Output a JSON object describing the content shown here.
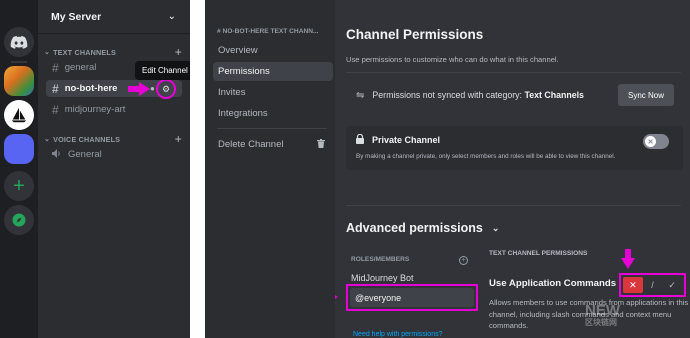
{
  "colors": {
    "highlight": "#e600d6",
    "blurple": "#5865f2",
    "deny_red": "#da373c",
    "link": "#00a8fc",
    "add_green": "#23a55a"
  },
  "server": {
    "name": "My Server",
    "dropdown_icon": "chevron-down-icon"
  },
  "server_rail": {
    "icons": [
      "discord-icon",
      "server-image-icon",
      "sailboat-server-icon",
      "active-server-icon",
      "add-server-icon",
      "explore-servers-icon"
    ],
    "add_symbol": "+"
  },
  "text_channels": {
    "label": "TEXT CHANNELS",
    "add_symbol": "+",
    "items": [
      {
        "hash": "#",
        "name": "general"
      },
      {
        "hash": "#",
        "name": "no-bot-here"
      },
      {
        "hash": "#",
        "name": "midjourney-art"
      }
    ]
  },
  "voice_channels": {
    "label": "VOICE CHANNELS",
    "add_symbol": "+",
    "items": [
      {
        "name": "General"
      }
    ]
  },
  "tooltip": {
    "text": "Edit Channel"
  },
  "settings_sidebar": {
    "header": "# NO-BOT-HERE TEXT CHANN...",
    "items": [
      {
        "label": "Overview"
      },
      {
        "label": "Permissions"
      },
      {
        "label": "Invites"
      },
      {
        "label": "Integrations"
      }
    ],
    "delete_label": "Delete Channel"
  },
  "permissions": {
    "title": "Channel Permissions",
    "description": "Use permissions to customize who can do what in this channel.",
    "sync": {
      "text_prefix": "Permissions not synced with category:",
      "category": "Text Channels",
      "button": "Sync Now"
    },
    "private": {
      "title": "Private Channel",
      "description": "By making a channel private, only select members and roles will be able to view this channel.",
      "enabled": false,
      "knob_symbol": "✕"
    },
    "advanced": {
      "title": "Advanced permissions",
      "chevron": "⌄",
      "roles_header": "ROLES/MEMBERS",
      "roles_add": "+",
      "roles": [
        {
          "label": "MidJourney Bot"
        },
        {
          "label": "@everyone"
        }
      ],
      "selected_role": "@everyone",
      "help_link": "Need help with permissions?",
      "section_header": "TEXT CHANNEL PERMISSIONS",
      "permission_name": "Use Application Commands",
      "permission_desc": "Allows members to use commands from applications in this channel, including slash commands and context menu commands.",
      "state": "deny",
      "deny_symbol": "✕",
      "neutral_symbol": "/",
      "allow_symbol": "✓"
    }
  },
  "watermark": {
    "big": "NEW",
    "small": "区块链网"
  }
}
